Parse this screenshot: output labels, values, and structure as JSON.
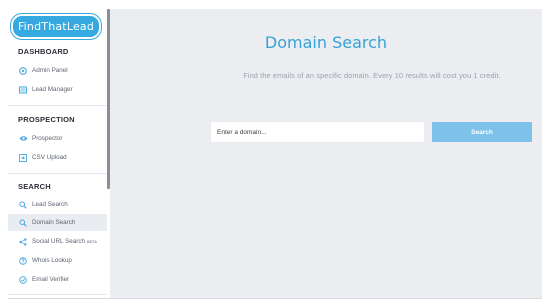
{
  "sidebar": {
    "logo_text": "FindThatLead",
    "sections": {
      "dashboard": {
        "title": "DASHBOARD",
        "items": [
          {
            "label": "Admin Panel",
            "icon": "dashboard-icon"
          },
          {
            "label": "Lead Manager",
            "icon": "lead-manager-icon"
          }
        ]
      },
      "prospection": {
        "title": "PROSPECTION",
        "items": [
          {
            "label": "Prospector",
            "icon": "eye-icon"
          },
          {
            "label": "CSV Upload",
            "icon": "upload-icon"
          }
        ]
      },
      "search": {
        "title": "SEARCH",
        "items": [
          {
            "label": "Lead Search",
            "icon": "search-icon"
          },
          {
            "label": "Domain Search",
            "icon": "search-icon",
            "active": true
          },
          {
            "label": "Social URL Search",
            "icon": "share-icon",
            "badge": "BETA"
          },
          {
            "label": "Whois Lookup",
            "icon": "question-icon"
          },
          {
            "label": "Email Verifier",
            "icon": "verify-icon"
          }
        ]
      }
    }
  },
  "main": {
    "title": "Domain Search",
    "subtitle": "Find the emails of an specific domain. Every 10 results will cost you 1 credit.",
    "domain_placeholder": "Enter a domain...",
    "search_label": "Search"
  },
  "colors": {
    "accent": "#35a9e0",
    "button": "#7ec2ea",
    "main_bg": "#ebedf0",
    "icon": "#4aa8de"
  }
}
